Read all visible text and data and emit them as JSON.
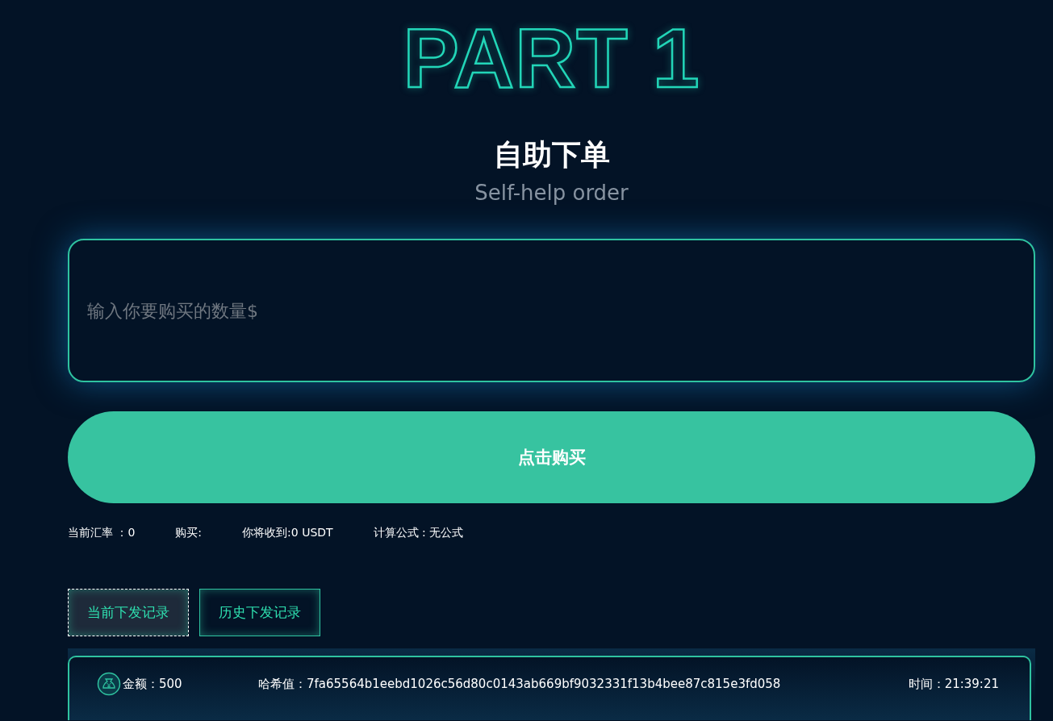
{
  "hero": {
    "title": "PART 1",
    "heading": "自助下单",
    "subtitle": "Self-help order"
  },
  "order": {
    "placeholder": "输入你要购买的数量$",
    "button": "点击购买"
  },
  "stats": [
    "当前汇率 ：0",
    "购买:",
    "你将收到:0 USDT",
    "计算公式 : 无公式"
  ],
  "tabs": [
    {
      "label": "当前下发记录",
      "selected": true
    },
    {
      "label": "历史下发记录",
      "selected": false
    }
  ],
  "records": [
    {
      "amount": "金额：500",
      "hash": "哈希值：7fa65564b1eebd1026c56d80c0143ab669bf9032331f13b4bee87c815e3fd058",
      "time": "时间：21:39:21"
    }
  ]
}
